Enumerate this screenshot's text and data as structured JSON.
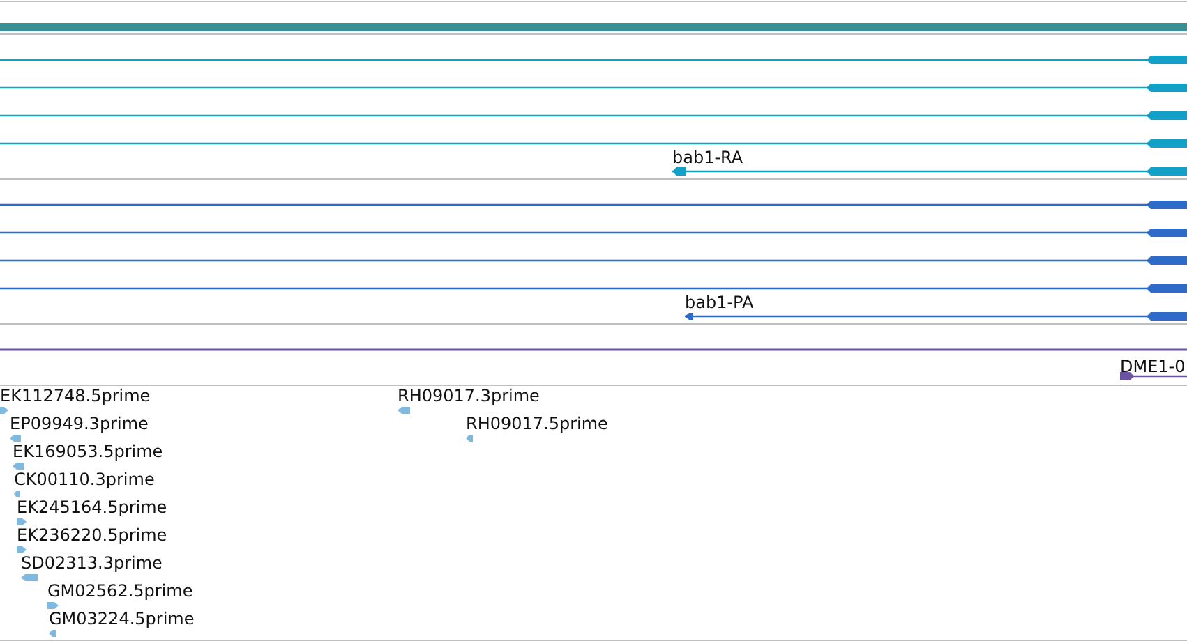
{
  "tracks": [
    {
      "kind": "bar",
      "color": "#3a8f94"
    },
    {
      "kind": "transcripts",
      "color": "#13a0c6",
      "rows": [
        {
          "reverse": true
        },
        {
          "reverse": true
        },
        {
          "reverse": true
        },
        {
          "reverse": true
        },
        {
          "reverse": true,
          "label": "bab1-RA"
        }
      ]
    },
    {
      "kind": "transcripts",
      "color": "#2e6bc9",
      "rows": [
        {
          "reverse": true
        },
        {
          "reverse": true
        },
        {
          "reverse": true
        },
        {
          "reverse": true
        },
        {
          "reverse": true,
          "label": "bab1-PA"
        }
      ]
    },
    {
      "kind": "genes",
      "color": "#6b52a3",
      "features": [
        {
          "kind": "span"
        },
        {
          "kind": "gene",
          "label": "DME1-0",
          "reverse": false
        }
      ]
    },
    {
      "kind": "ests",
      "color": "#80b9df",
      "features": [
        {
          "label": "EK112748.5prime",
          "reverse": false
        },
        {
          "label": "EP09949.3prime",
          "reverse": true
        },
        {
          "label": "EK169053.5prime",
          "reverse": true
        },
        {
          "label": "CK00110.3prime",
          "reverse": true
        },
        {
          "label": "EK245164.5prime",
          "reverse": false
        },
        {
          "label": "EK236220.5prime",
          "reverse": false
        },
        {
          "label": "SD02313.3prime",
          "reverse": true
        },
        {
          "label": "GM02562.5prime",
          "reverse": false
        },
        {
          "label": "GM03224.5prime",
          "reverse": true
        },
        {
          "label": "RH09017.3prime",
          "reverse": true
        },
        {
          "label": "RH09017.5prime",
          "reverse": true
        }
      ]
    }
  ]
}
